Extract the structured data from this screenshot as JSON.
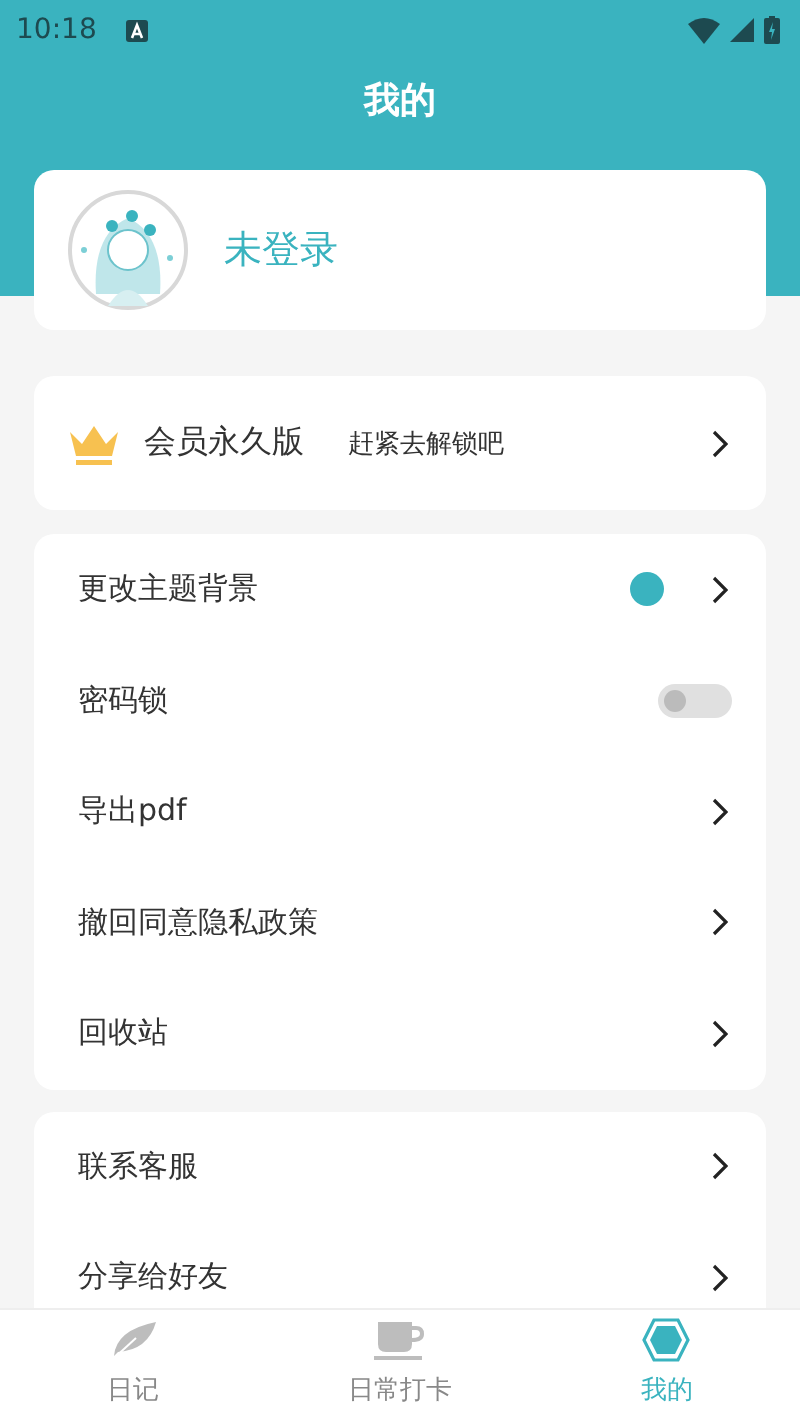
{
  "status_bar": {
    "time": "10:18"
  },
  "header": {
    "title": "我的"
  },
  "profile": {
    "name": "未登录"
  },
  "membership": {
    "title": "会员永久版",
    "subtitle": "赶紧去解锁吧"
  },
  "settings_groups": [
    {
      "items": [
        {
          "kind": "color",
          "label": "更改主题背景",
          "color": "#3ab3bf"
        },
        {
          "kind": "toggle",
          "label": "密码锁",
          "on": false
        },
        {
          "kind": "arrow",
          "label": "导出pdf"
        },
        {
          "kind": "arrow",
          "label": "撤回同意隐私政策"
        },
        {
          "kind": "arrow",
          "label": "回收站"
        }
      ]
    },
    {
      "items": [
        {
          "kind": "arrow",
          "label": "联系客服"
        },
        {
          "kind": "arrow",
          "label": "分享给好友"
        }
      ]
    }
  ],
  "bottom_nav": [
    {
      "label": "日记",
      "kind": "feather",
      "selected": false
    },
    {
      "label": "日常打卡",
      "kind": "cup",
      "selected": false
    },
    {
      "label": "我的",
      "kind": "hexagon",
      "selected": true
    }
  ]
}
